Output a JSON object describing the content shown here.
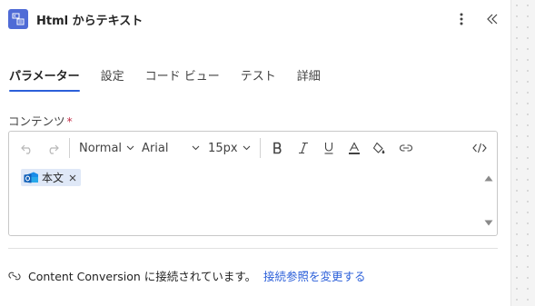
{
  "header": {
    "title": "Html からテキスト",
    "app_icon": "html-to-text-icon",
    "actions": [
      "more-vertical-icon",
      "collapse-left-icon"
    ]
  },
  "tabs": [
    {
      "label": "パラメーター",
      "active": true
    },
    {
      "label": "設定",
      "active": false
    },
    {
      "label": "コード ビュー",
      "active": false
    },
    {
      "label": "テスト",
      "active": false
    },
    {
      "label": "詳細",
      "active": false
    }
  ],
  "field": {
    "label": "コンテンツ",
    "required_mark": "*"
  },
  "toolbar": {
    "format": "Normal",
    "font": "Arial",
    "size": "15px",
    "icons": [
      "undo-icon",
      "redo-icon",
      "bold-icon",
      "italic-icon",
      "underline-icon",
      "font-color-icon",
      "highlight-icon",
      "link-icon",
      "code-view-icon"
    ]
  },
  "token": {
    "label": "本文",
    "icon": "outlook-icon"
  },
  "connection": {
    "text": "Content Conversion に接続されています。",
    "link": "接続参照を変更する",
    "icon": "connection-link-icon"
  },
  "colors": {
    "accent": "#2b5fd9",
    "app_icon_bg": "#4f6bd6",
    "token_bg": "#dfe8f7",
    "required": "#c4314b"
  }
}
